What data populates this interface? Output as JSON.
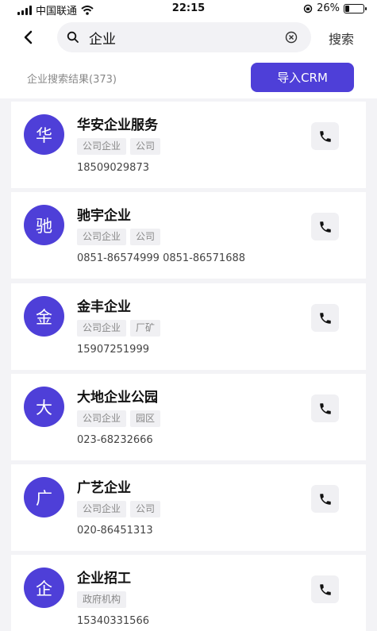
{
  "status_bar": {
    "carrier": "中国联通",
    "time": "22:15",
    "battery_text": "26%",
    "battery_level": 0.26
  },
  "search": {
    "query": "企业",
    "button_label": "搜索"
  },
  "results": {
    "count_text": "企业搜索结果(373)",
    "import_label": "导入CRM"
  },
  "accent_color": "#4e3fd8",
  "icons": [
    "signal-icon",
    "wifi-icon",
    "back-icon",
    "search-icon",
    "clear-icon",
    "phone-icon",
    "lock-rotation-icon"
  ],
  "companies": [
    {
      "avatar": "华",
      "name": "华安企业服务",
      "tags": [
        "公司企业",
        "公司"
      ],
      "phone": "18509029873"
    },
    {
      "avatar": "驰",
      "name": "驰宇企业",
      "tags": [
        "公司企业",
        "公司"
      ],
      "phone": "0851-86574999 0851-86571688"
    },
    {
      "avatar": "金",
      "name": "金丰企业",
      "tags": [
        "公司企业",
        "厂矿"
      ],
      "phone": "15907251999"
    },
    {
      "avatar": "大",
      "name": "大地企业公园",
      "tags": [
        "公司企业",
        "园区"
      ],
      "phone": "023-68232666"
    },
    {
      "avatar": "广",
      "name": "广艺企业",
      "tags": [
        "公司企业",
        "公司"
      ],
      "phone": "020-86451313"
    },
    {
      "avatar": "企",
      "name": "企业招工",
      "tags": [
        "政府机构"
      ],
      "phone": "15340331566"
    }
  ]
}
